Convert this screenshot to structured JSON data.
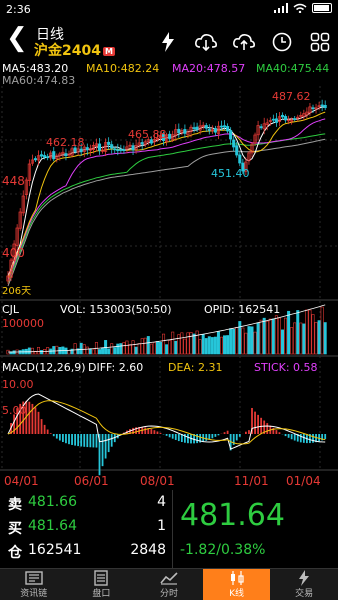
{
  "status": {
    "time": "2:36"
  },
  "header": {
    "period": "日线",
    "symbol": "沪金2404",
    "badge": "M"
  },
  "ma_legend": {
    "ma5": "MA5:483.20",
    "ma10": "MA10:482.24",
    "ma20": "MA20:478.57",
    "ma40": "MA40:475.44",
    "ma60": "MA60:474.83"
  },
  "colors": {
    "ma5": "#ffffff",
    "ma10": "#f1c40f",
    "ma20": "#e040fb",
    "ma40": "#2ecc40",
    "ma60": "#9e9e9e",
    "up": "#e53935",
    "down": "#26c6da",
    "price_label": "#e53935",
    "accent": "#ff7f1a"
  },
  "chart_data": {
    "type": "candlestick",
    "price_axis_labels": [
      "448",
      "400",
      "206天"
    ],
    "annotations": [
      {
        "text": "462.18",
        "kind": "high"
      },
      {
        "text": "465.88",
        "kind": "high"
      },
      {
        "text": "487.62",
        "kind": "high"
      },
      {
        "text": "451.40",
        "kind": "low"
      }
    ],
    "date_labels": [
      "04/01",
      "06/01",
      "08/01",
      "11/01",
      "01/04"
    ],
    "volume": {
      "label": "CJL",
      "vol": "VOL: 153003(50:50)",
      "opid": "OPID: 162541",
      "axis": "100000"
    },
    "macd": {
      "label": "MACD(12,26,9)",
      "diff": "DIFF: 2.60",
      "dea": "DEA: 2.31",
      "stick": "STICK: 0.58",
      "axis": [
        "10.00",
        "5.00"
      ]
    }
  },
  "quote": {
    "sell_label": "卖",
    "sell_price": "481.66",
    "sell_qty": "4",
    "buy_label": "买",
    "buy_price": "481.64",
    "buy_qty": "1",
    "oi_label": "仓",
    "oi_value": "162541",
    "oi_qty": "2848",
    "last": "481.64",
    "change": "-1.82/0.38%"
  },
  "tabs": [
    {
      "label": "资讯链",
      "icon": "news-icon"
    },
    {
      "label": "盘口",
      "icon": "orderbook-icon"
    },
    {
      "label": "分时",
      "icon": "intraday-icon"
    },
    {
      "label": "K线",
      "icon": "candlestick-icon",
      "active": true
    },
    {
      "label": "交易",
      "icon": "trade-icon"
    }
  ]
}
